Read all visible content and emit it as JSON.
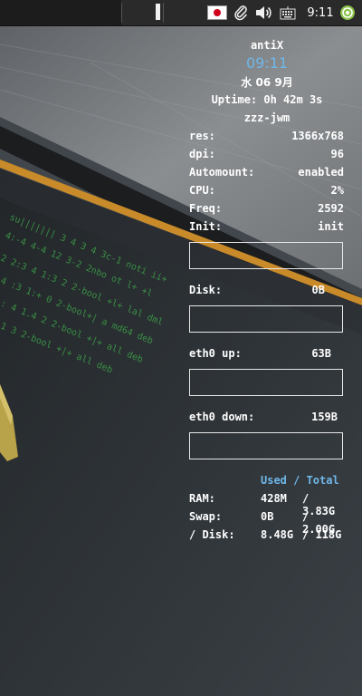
{
  "taskbar": {
    "clock": "9:11",
    "flag_icon": "japan-flag-icon",
    "icons": [
      "paperclip-icon",
      "volume-icon",
      "keyboard-icon",
      "network-status-icon"
    ]
  },
  "conky": {
    "hostname": "antiX",
    "time": "09:11",
    "date": "水 06  9月",
    "uptime": "Uptime: 0h 42m 3s",
    "wm": "zzz-jwm",
    "info": [
      {
        "label": "res:",
        "value": "1366x768"
      },
      {
        "label": "dpi:",
        "value": "96"
      },
      {
        "label": "Automount:",
        "value": "enabled"
      },
      {
        "label": "CPU:",
        "value": "2%"
      },
      {
        "label": "Freq:",
        "value": "2592"
      },
      {
        "label": "Init:",
        "value": "init"
      }
    ],
    "disk": {
      "label": "Disk:",
      "value": "0B"
    },
    "eth_up": {
      "label": "eth0 up:",
      "value": "63B"
    },
    "eth_down": {
      "label": "eth0 down:",
      "value": "159B"
    },
    "mem_header": "Used / Total",
    "mem": [
      {
        "label": "RAM:",
        "used": "428M",
        "total": "/ 3.83G"
      },
      {
        "label": "Swap:",
        "used": "0B",
        "total": "/ 2.00G"
      },
      {
        "label": "/ Disk:",
        "used": "8.48G",
        "total": "/ 118G"
      }
    ]
  },
  "colors": {
    "accent": "#6fb7e8",
    "text": "#ffffff",
    "taskbar": "#2a2a2a"
  }
}
